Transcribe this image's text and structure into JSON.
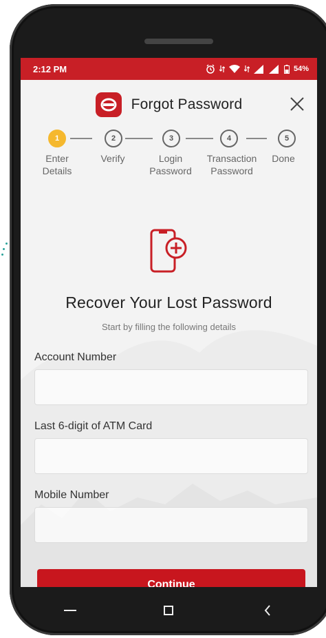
{
  "status_bar": {
    "time": "2:12 PM",
    "battery": "54%"
  },
  "header": {
    "title": "Forgot Password",
    "logo_icon": "bank-logo-icon",
    "close_icon": "close-icon"
  },
  "stepper": {
    "current_step": 1,
    "steps": [
      {
        "number": "1",
        "label_line1": "Enter",
        "label_line2": "Details"
      },
      {
        "number": "2",
        "label_line1": "Verify",
        "label_line2": ""
      },
      {
        "number": "3",
        "label_line1": "Login",
        "label_line2": "Password"
      },
      {
        "number": "4",
        "label_line1": "Transaction",
        "label_line2": "Password"
      },
      {
        "number": "5",
        "label_line1": "Done",
        "label_line2": ""
      }
    ]
  },
  "hero": {
    "icon": "mobile-add-icon",
    "title": "Recover Your Lost Password",
    "subtitle": "Start by filling the following details"
  },
  "form": {
    "account_number_label": "Account Number",
    "account_number_value": "",
    "atm_label": "Last 6-digit of ATM Card",
    "atm_value": "",
    "mobile_label": "Mobile Number",
    "mobile_value": "",
    "continue_label": "Continue"
  },
  "colors": {
    "brand_red": "#c81f26",
    "active_step": "#f5b82e"
  }
}
